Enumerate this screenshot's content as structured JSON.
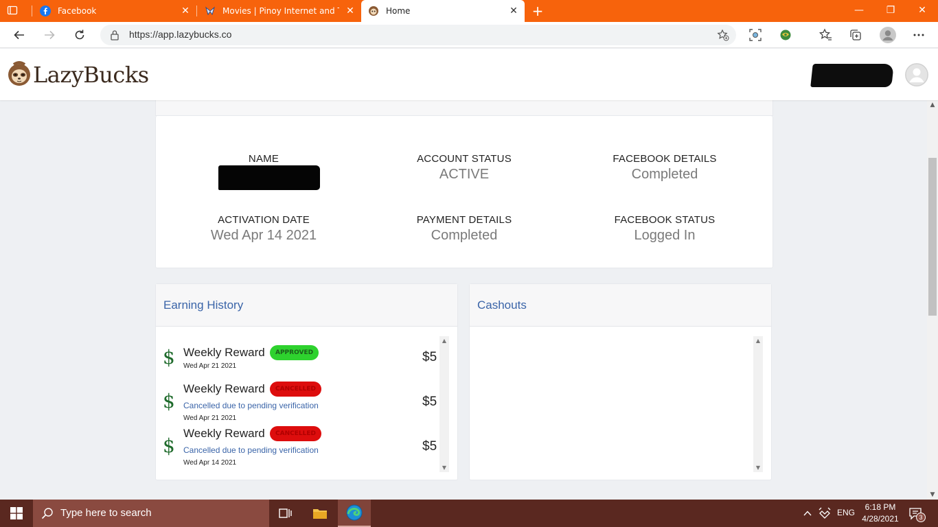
{
  "browser": {
    "tabs": [
      {
        "title": "Facebook",
        "favicon": "facebook-icon"
      },
      {
        "title": "Movies | Pinoy Internet and Tech",
        "favicon": "pinoy-tech-icon"
      },
      {
        "title": "Home",
        "favicon": "lazybucks-icon",
        "active": true
      }
    ],
    "url": "https://app.lazybucks.co"
  },
  "site": {
    "brand": "LazyBucks"
  },
  "account": {
    "fields": [
      {
        "label": "NAME",
        "value": ""
      },
      {
        "label": "ACCOUNT STATUS",
        "value": "ACTIVE"
      },
      {
        "label": "FACEBOOK DETAILS",
        "value": "Completed"
      },
      {
        "label": "ACTIVATION DATE",
        "value": "Wed Apr 14 2021"
      },
      {
        "label": "PAYMENT DETAILS",
        "value": "Completed"
      },
      {
        "label": "FACEBOOK STATUS",
        "value": "Logged In"
      }
    ]
  },
  "earning_history": {
    "title": "Earning History",
    "items": [
      {
        "title": "Weekly Reward",
        "status": "APPROVED",
        "note": "",
        "date": "Wed Apr 21 2021",
        "amount": "$5"
      },
      {
        "title": "Weekly Reward",
        "status": "CANCELLED",
        "note": "Cancelled due to pending verification",
        "date": "Wed Apr 21 2021",
        "amount": "$5"
      },
      {
        "title": "Weekly Reward",
        "status": "CANCELLED",
        "note": "Cancelled due to pending verification",
        "date": "Wed Apr 14 2021",
        "amount": "$5"
      }
    ]
  },
  "cashouts": {
    "title": "Cashouts"
  },
  "taskbar": {
    "search_placeholder": "Type here to search",
    "language": "ENG",
    "time": "6:18 PM",
    "date": "4/28/2021",
    "notification_count": "3"
  },
  "colors": {
    "browser_accent": "#f7630c",
    "link_blue": "#3a64a8",
    "approved": "#2ed22e",
    "cancelled": "#dd0d0d",
    "taskbar": "#5a2820"
  }
}
